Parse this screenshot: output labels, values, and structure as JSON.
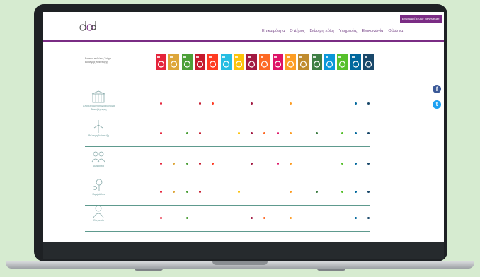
{
  "header": {
    "newsletter_label": "Εγγραφείτε στο Newsletter!",
    "nav": [
      "Επικαιρότητα",
      "Ο Δήμος",
      "Βιώσιμη πόλη",
      "Υπηρεσίες",
      "Επικοινωνία",
      "Θέλω να"
    ]
  },
  "table": {
    "header_label": "Βασικοί πυλώνες Στόχοι Βιώσιμης Ανάπτυξης",
    "sdg_colors": [
      "#e5243b",
      "#dda63a",
      "#4c9f38",
      "#c5192d",
      "#ff3a21",
      "#26bde2",
      "#fcc30b",
      "#a21942",
      "#fd6925",
      "#dd1367",
      "#fd9d24",
      "#bf8b2e",
      "#3f7e44",
      "#0a97d9",
      "#56c02b",
      "#00689d",
      "#19486a"
    ],
    "rows": [
      {
        "label": "Αποτελεσματική & καινοτόμα διακυβέρνηση",
        "icon": "government-building-icon",
        "dots": [
          1,
          4,
          5,
          8,
          11,
          16,
          17
        ]
      },
      {
        "label": "Βιώσιμη Ανάπτυξη",
        "icon": "wind-turbine-icon",
        "dots": [
          1,
          3,
          4,
          7,
          8,
          9,
          10,
          11,
          13,
          15,
          16,
          17
        ]
      },
      {
        "label": "Ασφάλεια",
        "icon": "people-group-icon",
        "dots": [
          1,
          2,
          3,
          4,
          5,
          8,
          10,
          11,
          15,
          16,
          17
        ]
      },
      {
        "label": "Περιβάλλον",
        "icon": "tree-recycle-icon",
        "dots": [
          1,
          2,
          3,
          4,
          7,
          11,
          13,
          15,
          16,
          17
        ]
      },
      {
        "label": "Ευημερία",
        "icon": "person-icon",
        "dots": [
          1,
          3,
          8,
          9,
          11,
          16,
          17
        ]
      }
    ]
  }
}
